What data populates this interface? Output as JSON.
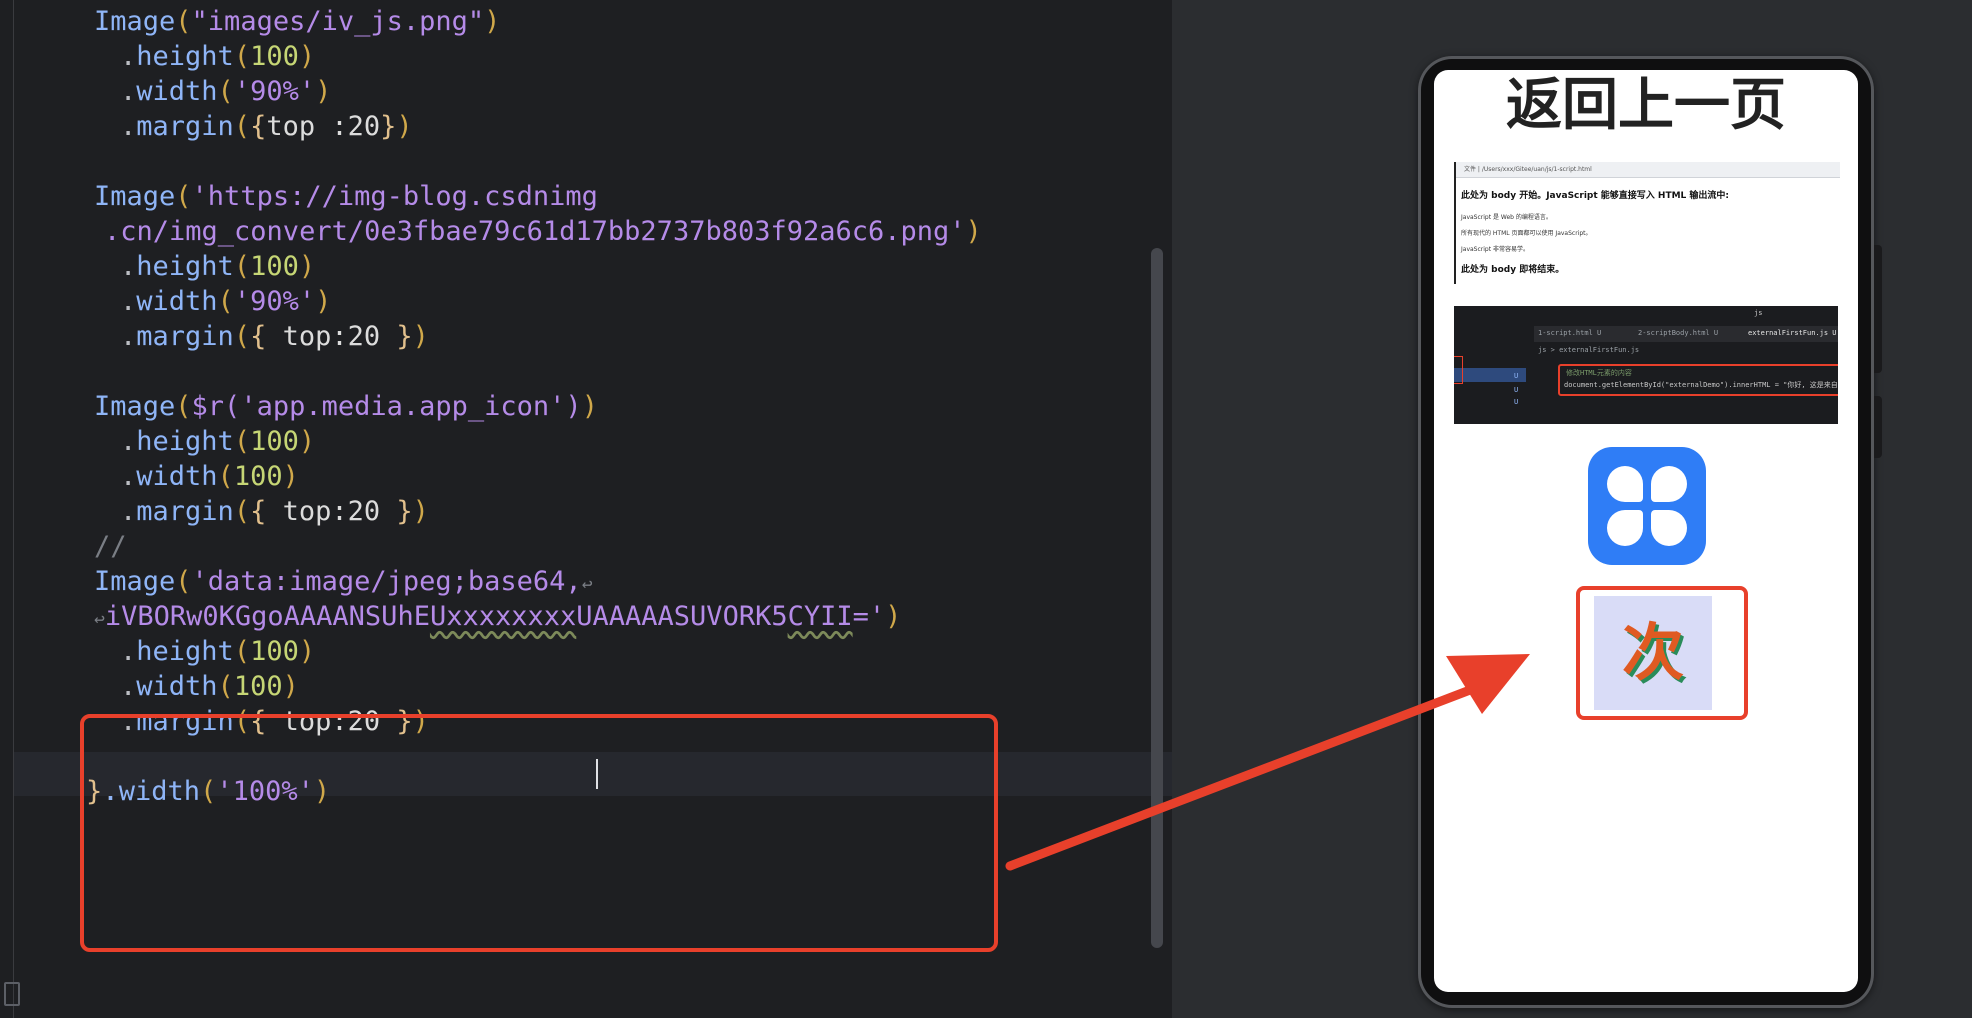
{
  "editor": {
    "lines": [
      {
        "indent": "  ",
        "name": "Image",
        "arg": "\"images/iv_js.png\""
      },
      {
        "chain": "height",
        "value": "100"
      },
      {
        "chain": "width",
        "value": "'90%'"
      },
      {
        "chain": "margin",
        "brace_text": "top :20"
      },
      {
        "indent": "  ",
        "name": "Image",
        "arg": "'https://img-blog.csdnimg"
      },
      {
        "continuation": ".cn/img_convert/0e3fbae79c61d17bb2737b803f92a6c6.png'"
      },
      {
        "chain": "height",
        "value": "100"
      },
      {
        "chain": "width",
        "value": "'90%'"
      },
      {
        "chain": "margin",
        "brace_text": " top:20 "
      },
      {
        "indent": "  ",
        "name": "Image",
        "arg": "$r('app.media.app_icon')"
      },
      {
        "chain": "height",
        "value": "100"
      },
      {
        "chain": "width",
        "value": "100"
      },
      {
        "chain": "margin",
        "brace_text": " top:20 "
      },
      {
        "comment": "//"
      },
      {
        "indent": "  ",
        "name": "Image",
        "arg": "'data:image/jpeg;base64,"
      },
      {
        "base64_a": "iVBORw0KGgoAAAANSUhE",
        "base64_b": "Uxxxxxxxx",
        "base64_c": "UAAAAASUVORK5",
        "base64_d": "CYII",
        "base64_e": "='"
      },
      {
        "chain": "height",
        "value": "100"
      },
      {
        "chain": "width",
        "value": "100"
      },
      {
        "chain": "margin",
        "brace_text": " top:20 "
      },
      {
        "closing": "}",
        "closing_call": ".width",
        "closing_arg": "'100%'"
      }
    ],
    "wrap_marker": "↩"
  },
  "phone": {
    "title": "返回上一页",
    "screenshot1": {
      "address": "文件 | /Users/xxx/Gitee/uan/js/1-script.html",
      "heading_start": "此处为 body 开始。JavaScript 能够直接写入 HTML 输出流中:",
      "line1": "JavaScript 是 Web 的编程语言。",
      "line2": "所有现代的 HTML 页面都可以使用 JavaScript。",
      "line3": "JavaScript 非常容易学。",
      "heading_end": "此处为 body 即将结束。"
    },
    "screenshot2": {
      "search": "js",
      "tab1": "1-script.html U",
      "tab2": "2-scriptBody.html U",
      "tab3": "externalFirstFun.js U",
      "breadcrumb": "js > externalFirstFun.js",
      "comment": "修改HTML元素的内容",
      "code": "document.getElementById(\"externalDemo\").innerHTML = \"你好, 这是来自外",
      "u_mark": "U"
    },
    "ci_glyph": "次"
  },
  "colors": {
    "highlight": "#e8402b",
    "icon_blue": "#2f7df6"
  }
}
